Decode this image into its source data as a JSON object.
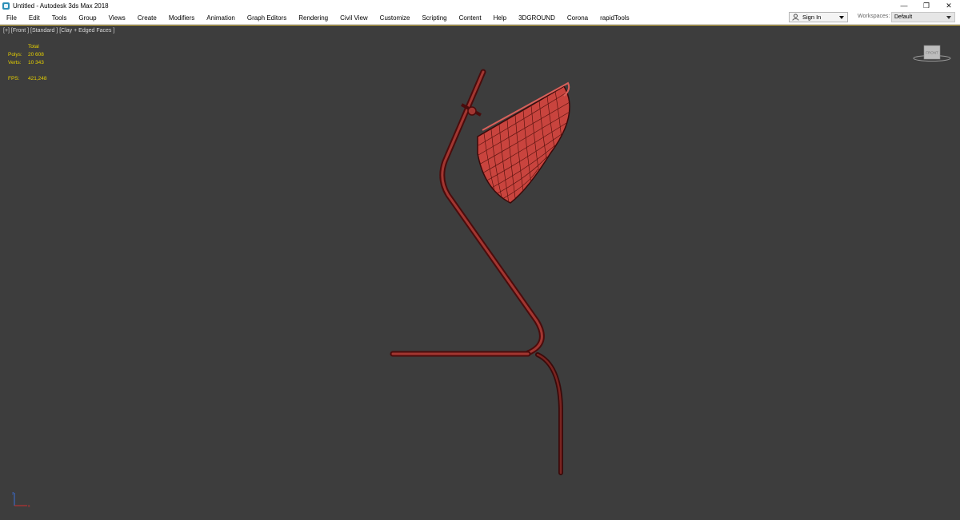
{
  "window": {
    "title": "Untitled - Autodesk 3ds Max 2018",
    "minimize_glyph": "—",
    "restore_glyph": "❐",
    "close_glyph": "✕"
  },
  "menu": {
    "items": [
      "File",
      "Edit",
      "Tools",
      "Group",
      "Views",
      "Create",
      "Modifiers",
      "Animation",
      "Graph Editors",
      "Rendering",
      "Civil View",
      "Customize",
      "Scripting",
      "Content",
      "Help",
      "3DGROUND",
      "Corona",
      "rapidTools"
    ]
  },
  "account": {
    "signin_label": "Sign In",
    "workspaces_label": "Workspaces:",
    "workspace_value": "Default"
  },
  "viewport": {
    "label": "[+] [Front ] [Standard ] [Clay + Edged Faces ]",
    "stats": {
      "header": "Total",
      "rows": [
        {
          "name": "Polys:",
          "value": "20 608"
        },
        {
          "name": "Verts:",
          "value": "10 343"
        }
      ],
      "fps_name": "FPS:",
      "fps_value": "421,248"
    },
    "viewcube_label": "FRONT"
  },
  "colors": {
    "viewport_bg": "#3d3d3d",
    "stats_text": "#e6d000",
    "model_fill": "#c9443e",
    "model_wire": "#4a0c0c"
  }
}
